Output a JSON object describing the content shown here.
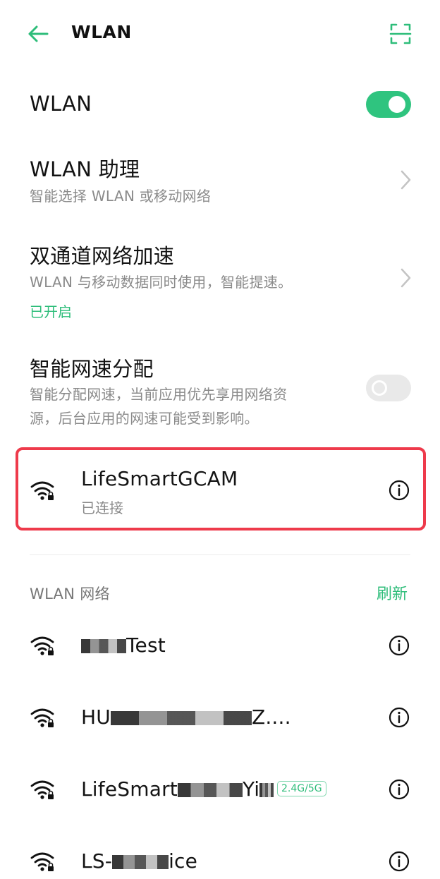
{
  "header": {
    "title": "WLAN",
    "back_icon": "arrow-left-icon",
    "scan_icon": "scan-qr-icon",
    "accent_color": "#2ebd7a"
  },
  "wlan_toggle": {
    "label": "WLAN",
    "enabled": true
  },
  "wlan_assistant": {
    "title": "WLAN 助理",
    "subtitle": "智能选择 WLAN 或移动网络"
  },
  "dual_channel": {
    "title": "双通道网络加速",
    "subtitle": "WLAN 与移动数据同时使用，智能提速。",
    "status": "已开启"
  },
  "smart_speed": {
    "title": "智能网速分配",
    "subtitle_line1": "智能分配网速，当前应用优先享用网络资",
    "subtitle_line2": "源，后台应用的网速可能受到影响。",
    "enabled": false
  },
  "connected_network": {
    "name": "LifeSmartGCAM",
    "status": "已连接",
    "highlight_color": "#ee3a4b"
  },
  "networks_section": {
    "title": "WLAN 网络",
    "refresh_label": "刷新"
  },
  "networks": [
    {
      "name_visible": "Test"
    },
    {
      "name_prefix": "HU",
      "name_suffix": "Z...."
    },
    {
      "name_prefix": "LifeSmart",
      "name_suffix": "Yi",
      "badge": "2.4G/5G"
    },
    {
      "name_prefix": "LS-",
      "name_suffix": "ice"
    }
  ]
}
